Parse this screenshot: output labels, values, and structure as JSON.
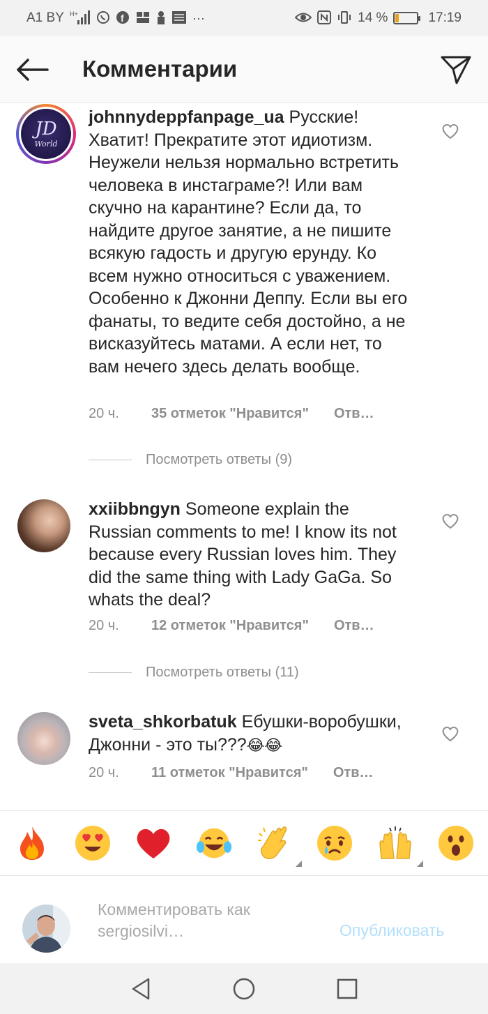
{
  "status_bar": {
    "carrier": "A1 BY",
    "network": "H+",
    "battery_percent_text": "14 %",
    "battery_level": 0.14,
    "time": "17:19",
    "icons": [
      "signal-icon",
      "whatsapp-icon",
      "facebook-icon",
      "sim-icon",
      "lock-icon",
      "image-icon",
      "more-icon",
      "eye-icon",
      "nfc-icon",
      "vibrate-icon",
      "battery-icon"
    ],
    "more_glyph": "···"
  },
  "header": {
    "title": "Комментарии",
    "back_icon": "arrow-left-icon",
    "send_icon": "paper-plane-icon"
  },
  "comments": [
    {
      "username": "johnnydeppfanpage_ua",
      "text": "Русские! Хватит! Прекратите этот идиотизм. Неужели нельзя нормально встретить человека в инстаграме?! Или вам скучно на карантине? Если да, то найдите другое занятие, а не пишите всякую гадость и другую ерунду. Ко всем нужно относиться с уважением. Особенно к Джонни Деппу. Если вы его фанаты, то ведите себя достойно, а не висказуйтесь матами. А если нет, то вам нечего здесь делать вообще.",
      "avatar_text": "JD",
      "avatar_subtext": "World",
      "time": "20 ч.",
      "likes": "35 отметок \"Нравится\"",
      "reply": "Отв…",
      "view_replies": "Посмотреть ответы (9)"
    },
    {
      "username": "xxiibbngyn",
      "text": "Someone explain the Russian comments to me! I know its not because every Russian loves him. They did the same thing with Lady GaGa. So whats the deal?",
      "time": "20 ч.",
      "likes": "12 отметок \"Нравится\"",
      "reply": "Отв…",
      "view_replies": "Посмотреть ответы (11)"
    },
    {
      "username": "sveta_shkorbatuk",
      "text": "Ебушки-воробушки, Джонни - это ты???",
      "text_emoji": "😂😂",
      "time": "20 ч.",
      "likes": "11 отметок \"Нравится\"",
      "reply": "Отв…"
    }
  ],
  "emoji_bar": {
    "emojis": [
      "🔥",
      "😍",
      "❤️",
      "😂",
      "👏",
      "😢",
      "🙌",
      "😮"
    ]
  },
  "input": {
    "placeholder_line1": "Комментировать как",
    "placeholder_line2": "sergiosilvi…",
    "publish": "Опубликовать"
  },
  "nav_bar": {
    "icons": [
      "back-triangle-icon",
      "home-circle-icon",
      "recents-square-icon"
    ]
  }
}
